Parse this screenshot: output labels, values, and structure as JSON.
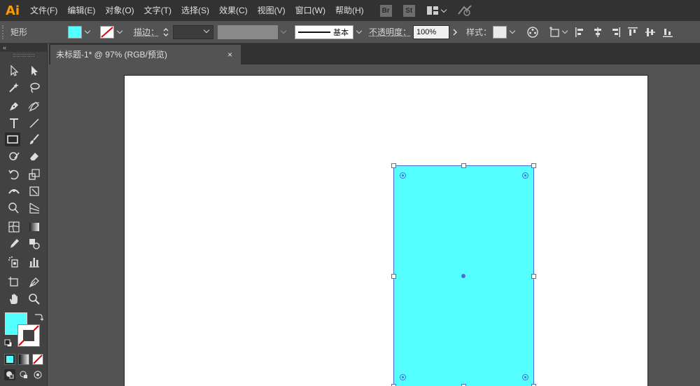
{
  "app": {
    "logo": "Ai"
  },
  "menu": [
    "文件(F)",
    "编辑(E)",
    "对象(O)",
    "文字(T)",
    "选择(S)",
    "效果(C)",
    "视图(V)",
    "窗口(W)",
    "帮助(H)"
  ],
  "menu_icons": {
    "bridge": "Br",
    "stock": "St"
  },
  "control": {
    "tool_name": "矩形",
    "fill_color": "#55ffff",
    "stroke_label": "描边：",
    "stroke_weight": "",
    "stroke_profile": "基本",
    "opacity_label": "不透明度：",
    "opacity_value": "100%",
    "style_label": "样式："
  },
  "document": {
    "tab_title": "未标题-1* @ 97% (RGB/预览)",
    "close": "×"
  },
  "panel": {
    "collapse": "«"
  },
  "artwork": {
    "rect_color": "#55ffff",
    "selection_color": "#4a6bd8"
  }
}
